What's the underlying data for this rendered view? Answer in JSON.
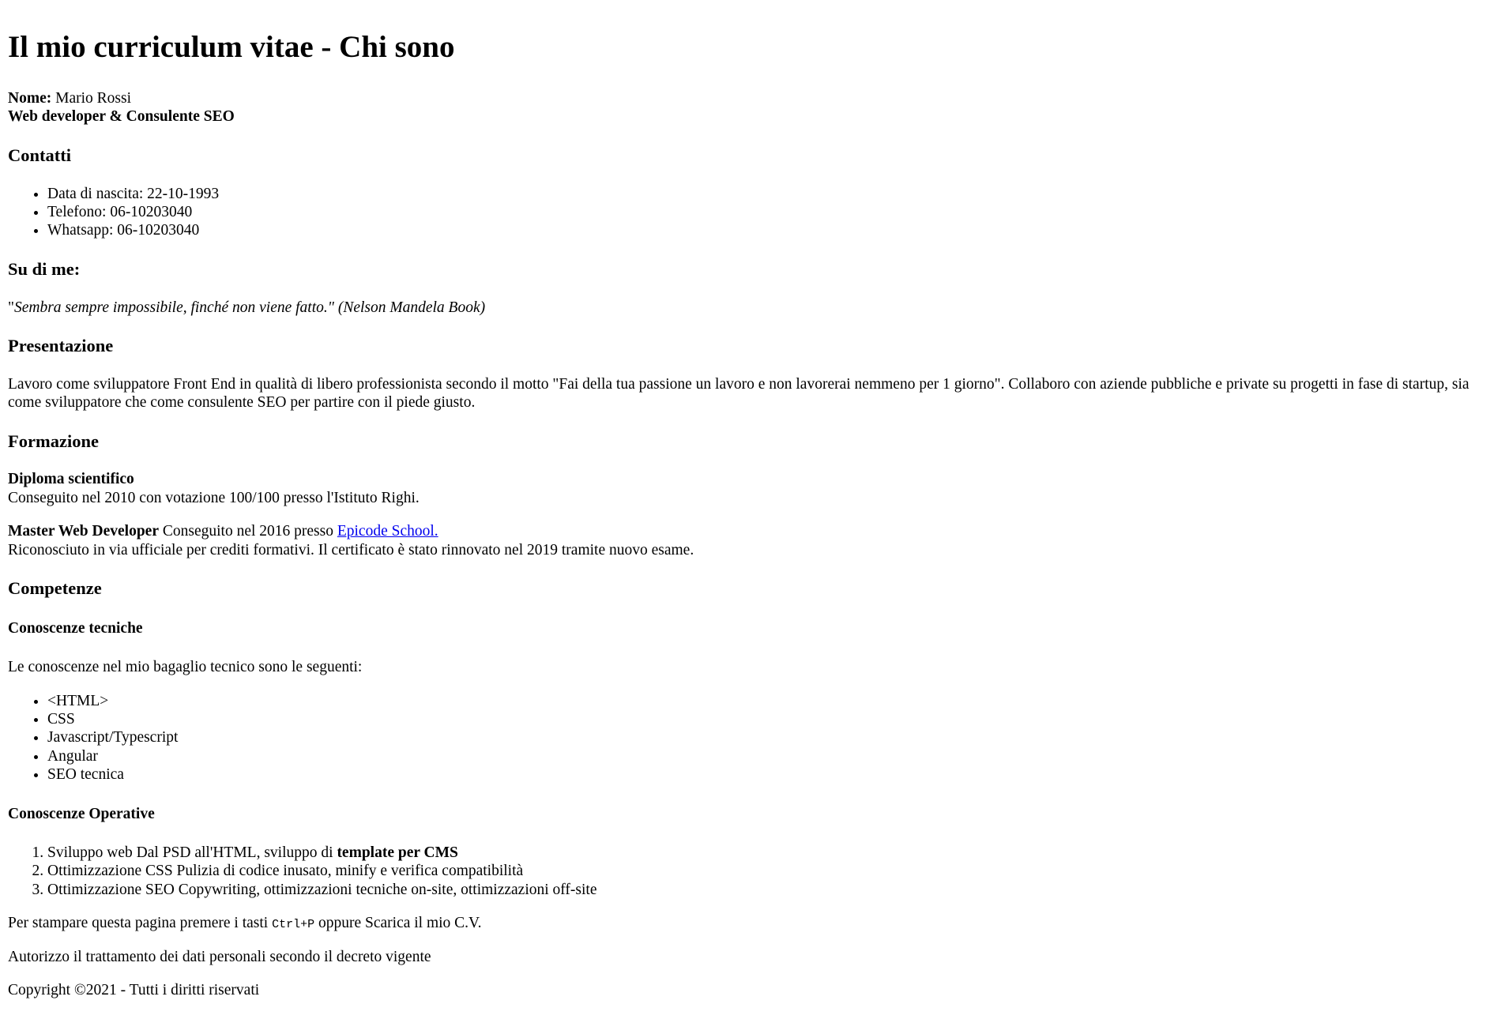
{
  "header": {
    "title": "Il mio curriculum vitae - Chi sono"
  },
  "identity": {
    "name_label": "Nome:",
    "name_value": " Mario Rossi",
    "role": "Web developer & Consulente SEO"
  },
  "contacts": {
    "heading": "Contatti",
    "items": [
      "Data di nascita: 22-10-1993",
      "Telefono: 06-10203040",
      "Whatsapp: 06-10203040"
    ]
  },
  "about": {
    "heading": "Su di me:",
    "quote_open": "\"",
    "quote_text": "Sembra sempre impossibile, finché non viene fatto.\" (Nelson Mandela Book)"
  },
  "presentation": {
    "heading": "Presentazione",
    "text": "Lavoro come sviluppatore Front End in qualità di libero professionista secondo il motto \"Fai della tua passione un lavoro e non lavorerai nemmeno per 1 giorno\". Collaboro con aziende pubbliche e private su progetti in fase di startup, sia come sviluppatore che come consulente SEO per partire con il piede giusto."
  },
  "education": {
    "heading": "Formazione",
    "diploma_title": "Diploma scientifico",
    "diploma_text": "Conseguito nel 2010 con votazione 100/100 presso l'Istituto Righi.",
    "master_title": "Master Web Developer",
    "master_text": " Conseguito nel 2016 presso ",
    "master_link": "Epicode School.",
    "master_note": "Riconosciuto in via ufficiale per crediti formativi. Il certificato è stato rinnovato nel 2019 tramite nuovo esame."
  },
  "skills": {
    "heading": "Competenze",
    "technical_heading": "Conoscenze tecniche",
    "technical_intro": "Le conoscenze nel mio bagaglio tecnico sono le seguenti:",
    "technical_items": [
      "<HTML>",
      "CSS",
      "Javascript/Typescript",
      "Angular",
      "SEO tecnica"
    ],
    "operative_heading": "Conoscenze Operative",
    "operative_items": [
      {
        "text": "Sviluppo web Dal PSD all'HTML, sviluppo di ",
        "bold": "template per CMS"
      },
      {
        "text": "Ottimizzazione CSS Pulizia di codice inusato, minify e verifica compatibilità",
        "bold": ""
      },
      {
        "text": "Ottimizzazione SEO Copywriting, ottimizzazioni tecniche on-site, ottimizzazioni off-site",
        "bold": ""
      }
    ]
  },
  "footer": {
    "print_before": "Per stampare questa pagina premere i tasti ",
    "print_keys": "Ctrl+P",
    "print_after": " oppure Scarica il mio C.V.",
    "consent": "Autorizzo il trattamento dei dati personali secondo il decreto vigente",
    "copyright": "Copyright ©2021 - Tutti i diritti riservati"
  }
}
